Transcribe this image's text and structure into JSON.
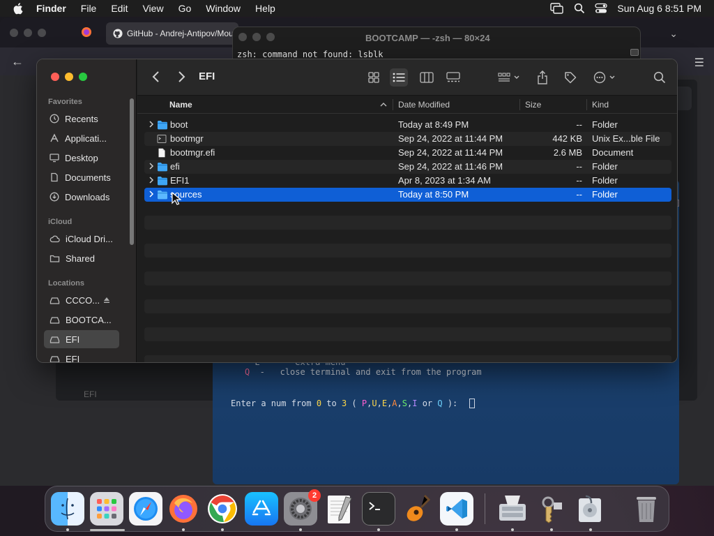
{
  "menubar": {
    "app": "Finder",
    "menus": [
      "File",
      "Edit",
      "View",
      "Go",
      "Window",
      "Help"
    ],
    "datetime": "Sun Aug 6  8:51 PM"
  },
  "browser": {
    "tab_title": "GitHub - Andrej-Antipov/Mou",
    "page_label": "EFI"
  },
  "terminal": {
    "title": "BOOTCAMP — -zsh — 80×24",
    "line1": "zsh: command not found: lsblk"
  },
  "bluepanel": {
    "menu_line_partial": "  E   -   extra menu",
    "quit_key": "Q",
    "quit_text": "  -   close terminal and exit from the program",
    "prompt_prefix": "Enter a num from ",
    "prompt_from": "0",
    "prompt_to_word": " to ",
    "prompt_to": "3",
    "prompt_open": " ( ",
    "keys": [
      "P",
      "U",
      "E",
      "A",
      "S",
      "I"
    ],
    "or_word": " or ",
    "last_key": "Q",
    "prompt_close": " ):  "
  },
  "finder": {
    "path_title": "EFI",
    "sidebar": {
      "favorites_header": "Favorites",
      "favorites": [
        "Recents",
        "Applicati...",
        "Desktop",
        "Documents",
        "Downloads"
      ],
      "icloud_header": "iCloud",
      "icloud": [
        "iCloud Dri...",
        "Shared"
      ],
      "locations_header": "Locations",
      "locations": [
        "CCCO...",
        "BOOTCA...",
        "EFI",
        "EFI"
      ]
    },
    "columns": {
      "name": "Name",
      "date": "Date Modified",
      "size": "Size",
      "kind": "Kind"
    },
    "files": [
      {
        "name": "boot",
        "date": "Today at 8:49 PM",
        "size": "--",
        "kind": "Folder",
        "type": "folder"
      },
      {
        "name": "bootmgr",
        "date": "Sep 24, 2022 at 11:44 PM",
        "size": "442 KB",
        "kind": "Unix Ex...ble File",
        "type": "exec"
      },
      {
        "name": "bootmgr.efi",
        "date": "Sep 24, 2022 at 11:44 PM",
        "size": "2.6 MB",
        "kind": "Document",
        "type": "doc"
      },
      {
        "name": "efi",
        "date": "Sep 24, 2022 at 11:46 PM",
        "size": "--",
        "kind": "Folder",
        "type": "folder"
      },
      {
        "name": "EFI1",
        "date": "Apr 8, 2023 at 1:34 AM",
        "size": "--",
        "kind": "Folder",
        "type": "folder"
      },
      {
        "name": "sources",
        "date": "Today at 8:50 PM",
        "size": "--",
        "kind": "Folder",
        "type": "folder",
        "selected": true
      }
    ]
  },
  "dock": {
    "apps": [
      "Finder",
      "Launchpad",
      "Safari",
      "Firefox",
      "Chrome",
      "App Store",
      "System Settings",
      "TextEdit",
      "Terminal",
      "GarageBand",
      "Visual Studio Code",
      "Boot Camp Assistant",
      "Keychain Access",
      "Disk Utility",
      "Trash"
    ],
    "settings_badge": "2"
  },
  "colors": {
    "accent": "#0f5fd6",
    "folder_blue": "#3fa6f5",
    "finder_bg": "#1e1e1e",
    "terminal_blue": "#1f4a7c"
  }
}
